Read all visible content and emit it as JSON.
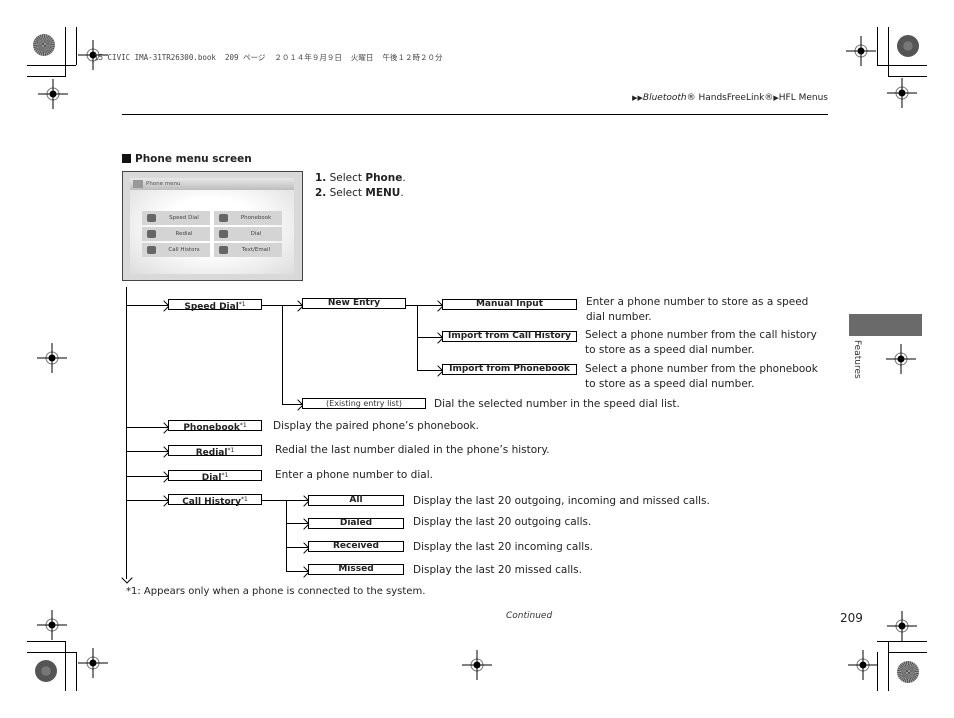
{
  "print_info": "15 CIVIC IMA-31TR26300.book  209 ページ  ２０１４年９月９日  火曜日  午後１２時２０分",
  "breadcrumb": {
    "items": [
      "Bluetooth® HandsFreeLink®",
      "HFL Menus"
    ],
    "italic_part": "Bluetooth",
    "reg1": "® HandsFreeLink®",
    "last": "HFL Menus"
  },
  "section_title": "Phone menu screen",
  "steps": [
    {
      "num": "1.",
      "pre": "Select ",
      "bold": "Phone",
      "post": "."
    },
    {
      "num": "2.",
      "pre": "Select ",
      "bold": "MENU",
      "post": "."
    }
  ],
  "phone_screen": {
    "title": "Phone menu",
    "buttons": [
      {
        "label": "Speed Dial",
        "icon": "speed-dial-icon"
      },
      {
        "label": "Phonebook",
        "icon": "phonebook-icon"
      },
      {
        "label": "Redial",
        "icon": "redial-icon"
      },
      {
        "label": "Dial",
        "icon": "keypad-icon"
      },
      {
        "label": "Call Histors",
        "icon": "call-history-icon"
      },
      {
        "label": "Text/Email",
        "icon": "envelope-icon"
      }
    ]
  },
  "tree": {
    "footnote_mark": "*1",
    "speed_dial": {
      "label": "Speed Dial"
    },
    "new_entry": {
      "label": "New Entry"
    },
    "manual_input": {
      "label": "Manual Input",
      "desc": "Enter a phone number to store as a speed dial number."
    },
    "import_call_history": {
      "label": "Import from Call History",
      "desc": "Select a phone number from the call history to store as a speed dial number."
    },
    "import_phonebook": {
      "label": "Import from Phonebook",
      "desc": "Select a phone number from the phonebook to store as a speed dial number."
    },
    "existing_list": {
      "label": "(Existing entry list)",
      "desc": "Dial the selected number in the speed dial list."
    },
    "phonebook": {
      "label": "Phonebook",
      "desc": "Display the paired phone’s phonebook."
    },
    "redial": {
      "label": "Redial",
      "desc": "Redial the last number dialed in the phone’s history."
    },
    "dial": {
      "label": "Dial",
      "desc": "Enter a phone number to dial."
    },
    "call_history": {
      "label": "Call History"
    },
    "all": {
      "label": "All",
      "desc": "Display the last 20 outgoing, incoming and missed calls."
    },
    "dialed": {
      "label": "Dialed",
      "desc": "Display the last 20 outgoing calls."
    },
    "received": {
      "label": "Received",
      "desc": "Display the last 20 incoming calls."
    },
    "missed": {
      "label": "Missed",
      "desc": "Display the last 20 missed calls."
    }
  },
  "footnote": "*1: Appears only when a phone is connected to the system.",
  "continued": "Continued",
  "page_number": "209",
  "side_tab": "Features"
}
